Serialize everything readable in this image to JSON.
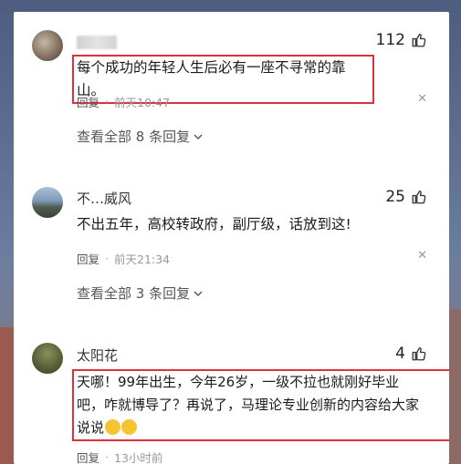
{
  "comments": [
    {
      "username": "",
      "likes": "112",
      "text": "每个成功的年轻人生后必有一座不寻常的靠山。",
      "reply_label": "回复",
      "time": "前天10:47",
      "view_all": "查看全部 8 条回复"
    },
    {
      "username": "不…威风",
      "likes": "25",
      "text": "不出五年，高校转政府，副厅级，话放到这!",
      "reply_label": "回复",
      "time": "前天21:34",
      "view_all": "查看全部 3 条回复"
    },
    {
      "username": "太阳花",
      "likes": "4",
      "text_line1": "天哪！99年出生，今年26岁，一级不拉也就刚好毕业",
      "text_line2": "吧，咋就博导了？再说了，马理论专业创新的内容给大家",
      "text_line3": "说说",
      "reply_label": "回复",
      "time": "13小时前"
    }
  ],
  "icons": {
    "like": "thumbs-up-icon",
    "close": "close-icon",
    "chevron": "chevron-down-icon"
  },
  "colors": {
    "highlight": "#e0303a",
    "panel": "#ffffff",
    "emoji": "#f7c431"
  }
}
